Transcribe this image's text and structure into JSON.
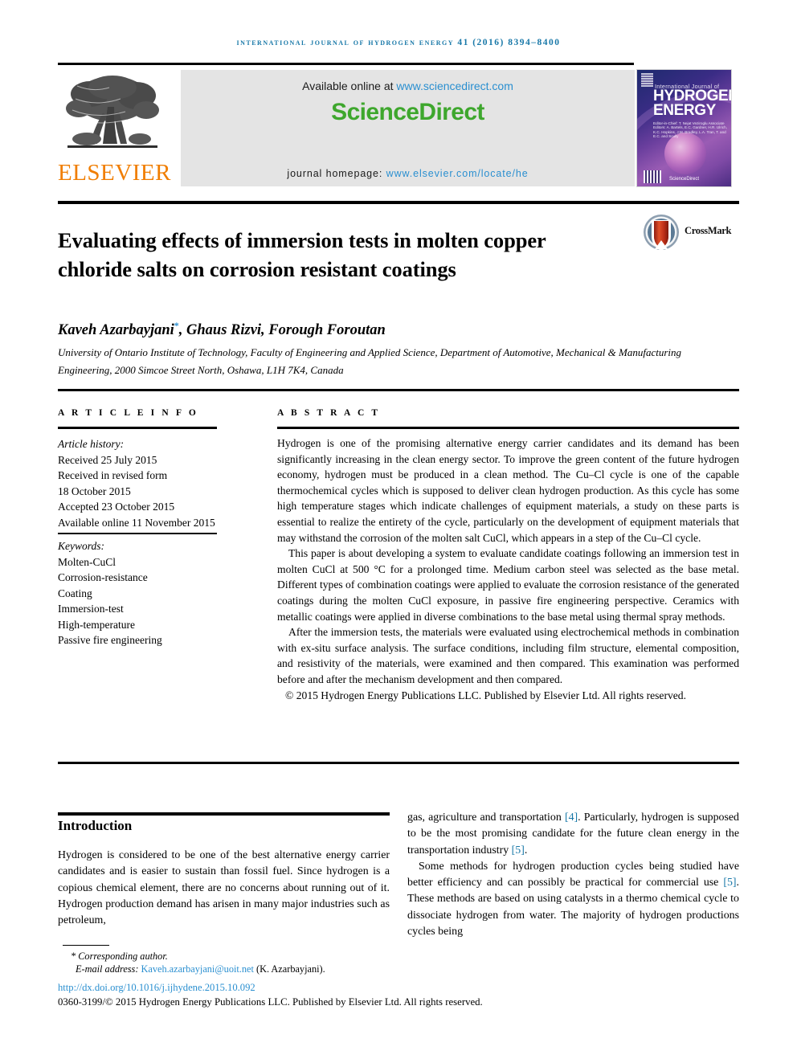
{
  "running_head": "International Journal of Hydrogen Energy 41 (2016) 8394–8400",
  "masthead": {
    "publisher_name": "ELSEVIER",
    "publisher_logo_alt": "elsevier-tree-logo",
    "available_prefix": "Available online at ",
    "available_url": "www.sciencedirect.com",
    "sciencedirect_logo": "ScienceDirect",
    "homepage_prefix": "journal homepage: ",
    "homepage_url": "www.elsevier.com/locate/he"
  },
  "cover": {
    "small_title": "International Journal of",
    "big_title_line1": "HYDROGEN",
    "big_title_line2": "ENERGY",
    "editors": "Editor-in-Chief: T. Nejat Veziroglu   Associate Editors: A. Bartels, E.C. Gardner, H.R. Ulrich, K.C. Hopkins, J.M. Bradley, L.A. Tran, T. and E.C. and Scully",
    "brand_bottom": "ScienceDirect"
  },
  "article": {
    "title": "Evaluating effects of immersion tests in molten copper chloride salts on corrosion resistant coatings",
    "crossmark_label": "CrossMark",
    "authors": "Kaveh Azarbayjani",
    "author_star": "*",
    "authors_rest": ", Ghaus Rizvi, Forough Foroutan",
    "affiliation": "University of Ontario Institute of Technology, Faculty of Engineering and Applied Science, Department of Automotive, Mechanical & Manufacturing Engineering, 2000 Simcoe Street North, Oshawa, L1H 7K4, Canada"
  },
  "sections": {
    "article_info_label": "A R T I C L E   I N F O",
    "abstract_label": "A B S T R A C T",
    "introduction_label": "Introduction"
  },
  "history": {
    "heading": "Article history:",
    "lines": [
      "Received 25 July 2015",
      "Received in revised form",
      "18 October 2015",
      "Accepted 23 October 2015",
      "Available online 11 November 2015"
    ]
  },
  "keywords": {
    "heading": "Keywords:",
    "items": [
      "Molten-CuCl",
      "Corrosion-resistance",
      "Coating",
      "Immersion-test",
      "High-temperature",
      "Passive fire engineering"
    ]
  },
  "abstract": {
    "p1": "Hydrogen is one of the promising alternative energy carrier candidates and its demand has been significantly increasing in the clean energy sector. To improve the green content of the future hydrogen economy, hydrogen must be produced in a clean method. The Cu–Cl cycle is one of the capable thermochemical cycles which is supposed to deliver clean hydrogen production. As this cycle has some high temperature stages which indicate challenges of equipment materials, a study on these parts is essential to realize the entirety of the cycle, particularly on the development of equipment materials that may withstand the corrosion of the molten salt CuCl, which appears in a step of the Cu–Cl cycle.",
    "p2": "This paper is about developing a system to evaluate candidate coatings following an immersion test in molten CuCl at 500 °C for a prolonged time. Medium carbon steel was selected as the base metal. Different types of combination coatings were applied to evaluate the corrosion resistance of the generated coatings during the molten CuCl exposure, in passive fire engineering perspective. Ceramics with metallic coatings were applied in diverse combinations to the base metal using thermal spray methods.",
    "p3": "After the immersion tests, the materials were evaluated using electrochemical methods in combination with ex-situ surface analysis. The surface conditions, including film structure, elemental composition, and resistivity of the materials, were examined and then compared. This examination was performed before and after the mechanism development and then compared.",
    "copyright": "© 2015 Hydrogen Energy Publications LLC. Published by Elsevier Ltd. All rights reserved."
  },
  "body": {
    "left_p1": "Hydrogen is considered to be one of the best alternative energy carrier candidates and is easier to sustain than fossil fuel. Since hydrogen is a copious chemical element, there are no concerns about running out of it. Hydrogen production demand has arisen in many major industries such as petroleum,",
    "right_p1_a": "gas, agriculture and transportation ",
    "right_p1_ref1": "[4]",
    "right_p1_b": ". Particularly, hydrogen is supposed to be the most promising candidate for the future clean energy in the transportation industry ",
    "right_p1_ref2": "[5]",
    "right_p1_c": ".",
    "right_p2_a": "Some methods for hydrogen production cycles being studied have better efficiency and can possibly be practical for commercial use ",
    "right_p2_ref1": "[5]",
    "right_p2_b": ". These methods are based on using catalysts in a thermo chemical cycle to dissociate hydrogen from water. The majority of hydrogen productions cycles being"
  },
  "footer": {
    "corresponding": "* Corresponding author.",
    "email_label": "E-mail address: ",
    "email": "Kaveh.azarbayjani@uoit.net",
    "email_suffix": " (K. Azarbayjani).",
    "doi": "http://dx.doi.org/10.1016/j.ijhydene.2015.10.092",
    "issn": "0360-3199/© 2015 Hydrogen Energy Publications LLC. Published by Elsevier Ltd. All rights reserved."
  },
  "colors": {
    "link_blue": "#2a8fd0",
    "running_head_blue": "#1878a8",
    "elsevier_orange": "#f07d00",
    "sciencedirect_green": "#3ea72d"
  }
}
